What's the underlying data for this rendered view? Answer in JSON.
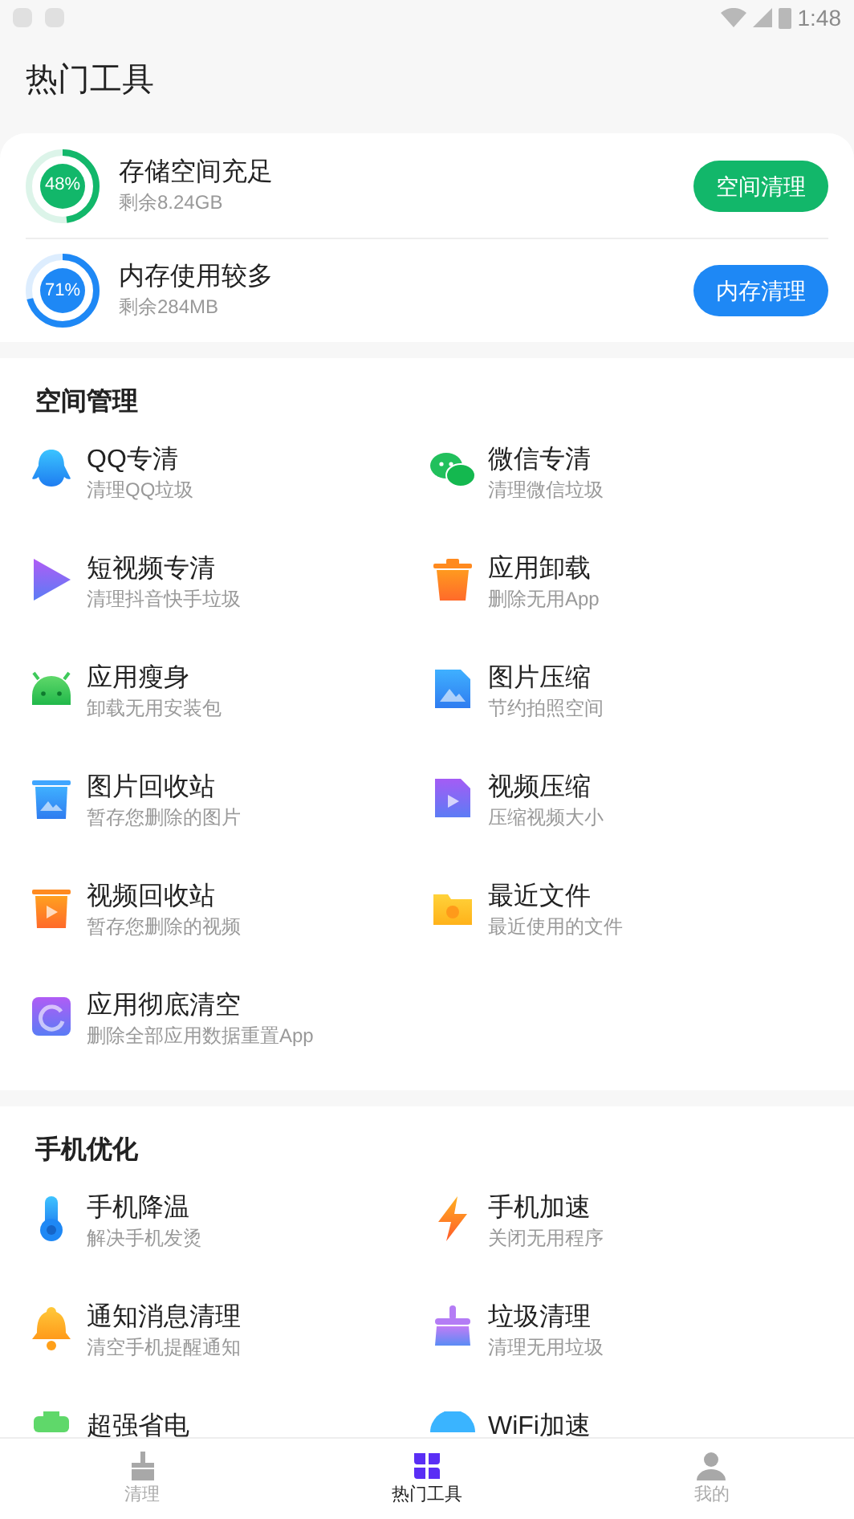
{
  "status_bar": {
    "time": "1:48"
  },
  "header": {
    "title": "热门工具"
  },
  "summary": [
    {
      "title": "存储空间充足",
      "subtitle": "剩余8.24GB",
      "percent": "48%",
      "level": 0.48,
      "color": "#12b76a",
      "button": "空间清理"
    },
    {
      "title": "内存使用较多",
      "subtitle": "剩余284MB",
      "percent": "71%",
      "level": 0.71,
      "color": "#1e88f5",
      "button": "内存清理"
    }
  ],
  "sections": [
    {
      "title": "空间管理",
      "items": [
        {
          "title": "QQ专清",
          "subtitle": "清理QQ垃圾"
        },
        {
          "title": "微信专清",
          "subtitle": "清理微信垃圾"
        },
        {
          "title": "短视频专清",
          "subtitle": "清理抖音快手垃圾"
        },
        {
          "title": "应用卸载",
          "subtitle": "删除无用App"
        },
        {
          "title": "应用瘦身",
          "subtitle": "卸载无用安装包"
        },
        {
          "title": "图片压缩",
          "subtitle": "节约拍照空间"
        },
        {
          "title": "图片回收站",
          "subtitle": "暂存您删除的图片"
        },
        {
          "title": "视频压缩",
          "subtitle": "压缩视频大小"
        },
        {
          "title": "视频回收站",
          "subtitle": "暂存您删除的视频"
        },
        {
          "title": "最近文件",
          "subtitle": "最近使用的文件"
        },
        {
          "title": "应用彻底清空",
          "subtitle": "删除全部应用数据重置App"
        }
      ]
    },
    {
      "title": "手机优化",
      "items": [
        {
          "title": "手机降温",
          "subtitle": "解决手机发烫"
        },
        {
          "title": "手机加速",
          "subtitle": "关闭无用程序"
        },
        {
          "title": "通知消息清理",
          "subtitle": "清空手机提醒通知"
        },
        {
          "title": "垃圾清理",
          "subtitle": "清理无用垃圾"
        },
        {
          "title": "超强省电"
        },
        {
          "title": "WiFi加速"
        }
      ]
    }
  ],
  "bottom_nav": [
    {
      "label": "清理",
      "selected": false
    },
    {
      "label": "热门工具",
      "selected": true
    },
    {
      "label": "我的",
      "selected": false
    }
  ]
}
